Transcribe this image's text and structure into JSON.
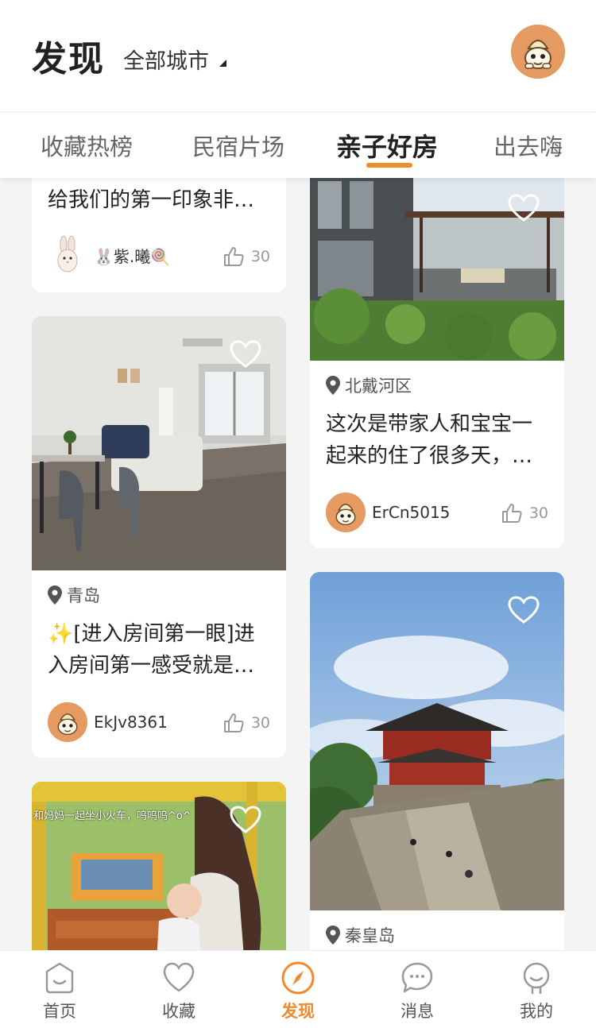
{
  "header": {
    "title": "发现",
    "city_selector": "全部城市"
  },
  "tabs": [
    {
      "label": "收藏热榜",
      "active": false
    },
    {
      "label": "民宿片场",
      "active": false
    },
    {
      "label": "亲子好房",
      "active": true
    },
    {
      "label": "出去嗨",
      "active": false
    }
  ],
  "feed": {
    "left": [
      {
        "description": "给我们的第一印象非常好，房间干净整洁",
        "author": "🐰紫.曦🍭",
        "likes": "30"
      },
      {
        "location": "青岛",
        "description": "✨[进入房间第一眼]进入房间第一感受就是很温馨",
        "author": "EkJv8361",
        "likes": "30"
      },
      {
        "photo_caption": "和妈妈一起坐小火车，呜呜呜^o^"
      }
    ],
    "right": [
      {
        "location": "北戴河区",
        "description": "这次是带家人和宝宝一起来的住了很多天，体验很好",
        "author": "ErCn5015",
        "likes": "30"
      },
      {
        "location": "秦皇岛"
      }
    ]
  },
  "bottom_nav": [
    {
      "label": "首页",
      "icon": "home-icon",
      "active": false
    },
    {
      "label": "收藏",
      "icon": "heart-icon",
      "active": false
    },
    {
      "label": "发现",
      "icon": "compass-icon",
      "active": true
    },
    {
      "label": "消息",
      "icon": "chat-icon",
      "active": false
    },
    {
      "label": "我的",
      "icon": "profile-icon",
      "active": false
    }
  ],
  "colors": {
    "accent": "#f08a2c",
    "avatar_bg": "#e59a62",
    "background": "#f4f4f4"
  }
}
